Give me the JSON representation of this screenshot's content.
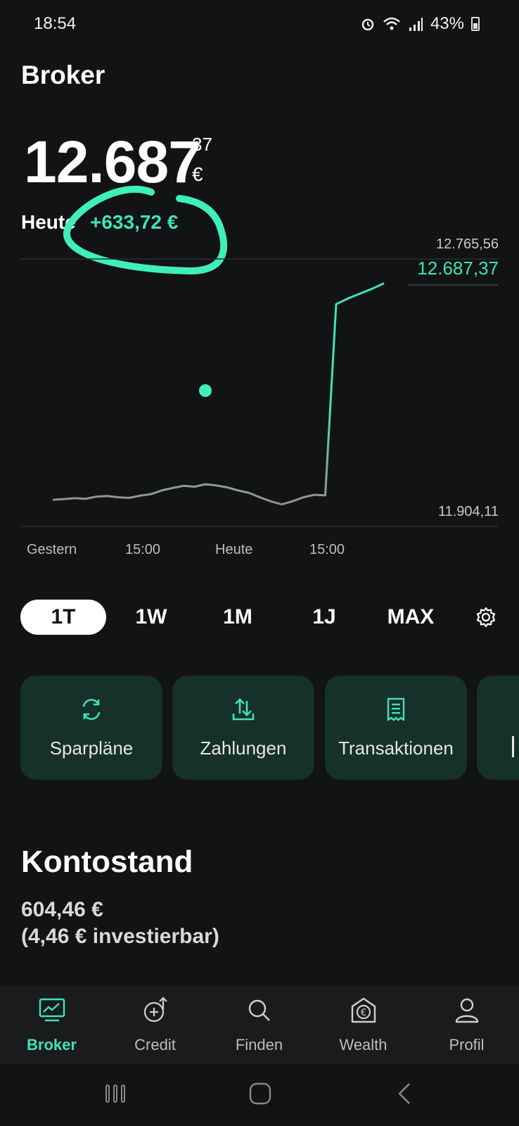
{
  "status_bar": {
    "time": "18:54",
    "battery": "43%"
  },
  "header": {
    "title": "Broker"
  },
  "portfolio": {
    "value_main": "12.687",
    "value_cents": "37",
    "currency": "€",
    "today_label": "Heute",
    "today_change": "+633,72 €"
  },
  "chart": {
    "high_label": "12.765,56",
    "current_label": "12.687,37",
    "low_label": "11.904,11",
    "x_ticks": [
      "Gestern",
      "15:00",
      "Heute",
      "15:00"
    ]
  },
  "chart_data": {
    "type": "line",
    "series": [
      {
        "values": [
          11990,
          11992,
          11995,
          11993,
          12000,
          12002,
          11998,
          11996,
          12003,
          12008,
          12020,
          12028,
          12035,
          12032,
          12040,
          12036,
          12030,
          12020,
          12012,
          11998,
          11985,
          11975,
          11985,
          11998,
          12006,
          12004,
          12620,
          12640,
          12655,
          12670,
          12687.37
        ]
      }
    ],
    "ylim": [
      11904.11,
      12765.56
    ],
    "xlabel": "",
    "ylabel": ""
  },
  "range_tabs": [
    "1T",
    "1W",
    "1M",
    "1J",
    "MAX"
  ],
  "range_selected": "1T",
  "actions": [
    {
      "label": "Sparpläne",
      "icon": "refresh-icon"
    },
    {
      "label": "Zahlungen",
      "icon": "transfer-icon"
    },
    {
      "label": "Transaktionen",
      "icon": "receipt-icon"
    }
  ],
  "kontostand": {
    "title": "Kontostand",
    "value": "604,46 €",
    "investable": "(4,46 € investierbar)"
  },
  "nav": [
    {
      "label": "Broker",
      "icon": "chart-screen-icon"
    },
    {
      "label": "Credit",
      "icon": "credit-icon"
    },
    {
      "label": "Finden",
      "icon": "search-icon"
    },
    {
      "label": "Wealth",
      "icon": "wealth-icon"
    },
    {
      "label": "Profil",
      "icon": "profile-icon"
    }
  ],
  "colors": {
    "accent": "#3fe3b3",
    "background": "#121314",
    "card": "#16302a"
  }
}
